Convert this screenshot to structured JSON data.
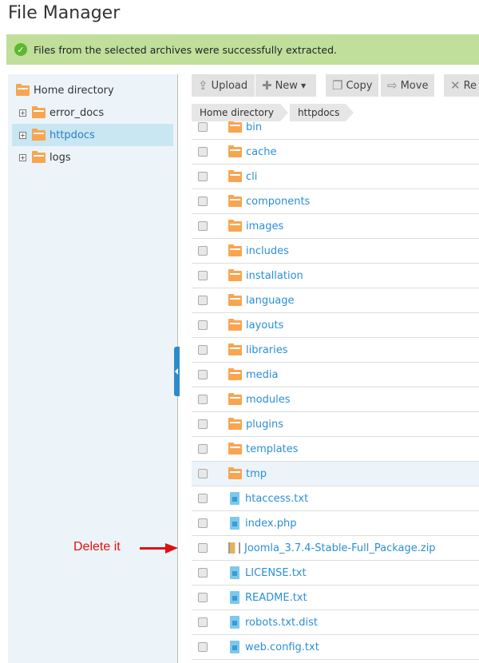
{
  "title": "File Manager",
  "banner": {
    "message": "Files from the selected archives were successfully extracted.",
    "icon": "check-circle-icon",
    "color": "#c0df9a"
  },
  "tree": {
    "root": "Home directory",
    "items": [
      {
        "label": "error_docs",
        "selected": false
      },
      {
        "label": "httpdocs",
        "selected": true
      },
      {
        "label": "logs",
        "selected": false
      }
    ]
  },
  "toolbar": {
    "upload": "Upload",
    "new": "New",
    "copy": "Copy",
    "move": "Move",
    "remove": "Re"
  },
  "breadcrumb": [
    "Home directory",
    "httpdocs"
  ],
  "files": [
    {
      "name": "bin",
      "type": "folder"
    },
    {
      "name": "cache",
      "type": "folder"
    },
    {
      "name": "cli",
      "type": "folder"
    },
    {
      "name": "components",
      "type": "folder"
    },
    {
      "name": "images",
      "type": "folder"
    },
    {
      "name": "includes",
      "type": "folder"
    },
    {
      "name": "installation",
      "type": "folder"
    },
    {
      "name": "language",
      "type": "folder"
    },
    {
      "name": "layouts",
      "type": "folder"
    },
    {
      "name": "libraries",
      "type": "folder"
    },
    {
      "name": "media",
      "type": "folder"
    },
    {
      "name": "modules",
      "type": "folder"
    },
    {
      "name": "plugins",
      "type": "folder"
    },
    {
      "name": "templates",
      "type": "folder"
    },
    {
      "name": "tmp",
      "type": "folder",
      "hover": true
    },
    {
      "name": "htaccess.txt",
      "type": "file"
    },
    {
      "name": "index.php",
      "type": "file"
    },
    {
      "name": "Joomla_3.7.4-Stable-Full_Package.zip",
      "type": "zip"
    },
    {
      "name": "LICENSE.txt",
      "type": "file"
    },
    {
      "name": "README.txt",
      "type": "file"
    },
    {
      "name": "robots.txt.dist",
      "type": "file"
    },
    {
      "name": "web.config.txt",
      "type": "file"
    }
  ],
  "annotation": {
    "text": "Delete it",
    "color": "#e01010"
  }
}
